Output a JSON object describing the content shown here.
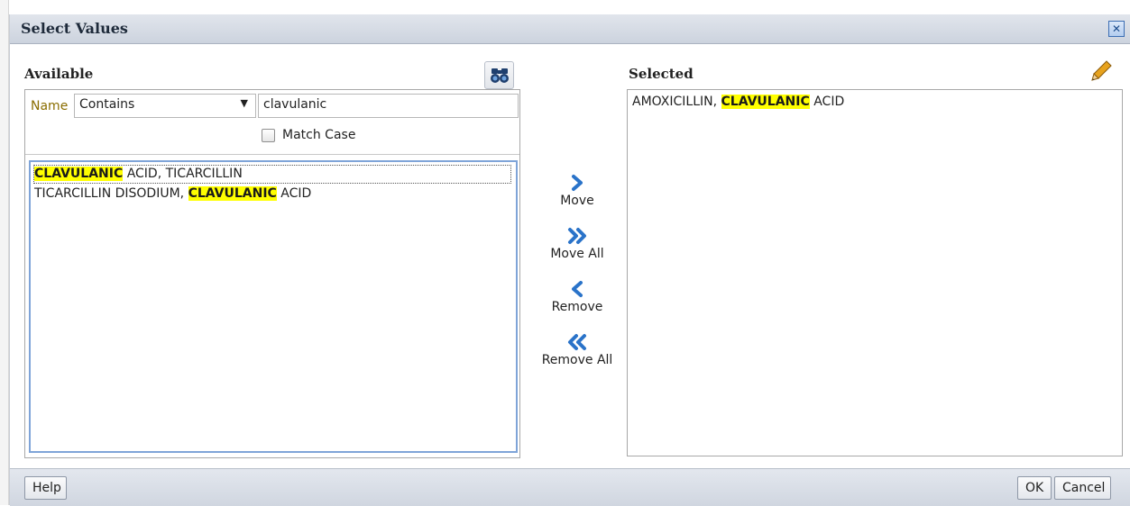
{
  "dialog": {
    "title": "Select Values"
  },
  "available": {
    "heading": "Available",
    "filter": {
      "name_label": "Name",
      "operator": "Contains",
      "search_value": "clavulanic",
      "match_case_label": "Match Case",
      "match_case_checked": false
    },
    "items": [
      {
        "pre": "",
        "hl": "CLAVULANIC",
        "post": " ACID, TICARCILLIN"
      },
      {
        "pre": "TICARCILLIN DISODIUM, ",
        "hl": "CLAVULANIC",
        "post": " ACID"
      }
    ]
  },
  "shuttle": {
    "move_label": "Move",
    "move_all_label": "Move All",
    "remove_label": "Remove",
    "remove_all_label": "Remove All"
  },
  "selected": {
    "heading": "Selected",
    "items": [
      {
        "pre": "AMOXICILLIN, ",
        "hl": "CLAVULANIC",
        "post": " ACID"
      }
    ]
  },
  "footer": {
    "help_label": "Help",
    "ok_label": "OK",
    "cancel_label": "Cancel"
  },
  "icons": {
    "search": "binoculars-icon",
    "edit": "pencil-icon",
    "close": "close-icon",
    "move": "chevron-right-icon",
    "move_all": "double-chevron-right-icon",
    "remove": "chevron-left-icon",
    "remove_all": "double-chevron-left-icon"
  },
  "colors": {
    "highlight": "#ffff00",
    "accent": "#2a73c9",
    "name_label": "#8a6d00"
  }
}
